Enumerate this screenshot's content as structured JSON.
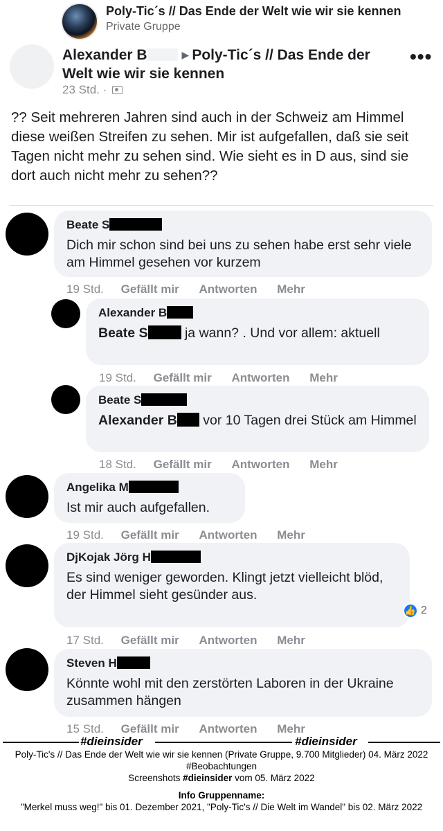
{
  "group": {
    "name": "Poly-Tic´s // Das Ende der Welt wie wir sie kennen",
    "type": "Private Gruppe"
  },
  "post": {
    "author": "Alexander B",
    "target_group_line1": "Poly-Tic´s // Das Ende der",
    "target_group_line2": "Welt wie wir sie kennen",
    "time": "23 Std. ·",
    "more_icon": "•••",
    "body": "?? Seit mehreren Jahren sind auch in der Schweiz am Himmel diese weißen Streifen zu sehen. Mir ist aufgefallen, daß sie seit Tagen nicht mehr zu sehen sind. Wie sieht es in D aus, sind sie dort auch nicht mehr zu sehen??"
  },
  "actions_labels": {
    "like": "Gefällt mir",
    "reply": "Antworten",
    "more": "Mehr"
  },
  "comments": [
    {
      "name": "Beate S",
      "text": "Dich mir schon sind bei uns zu sehen habe erst sehr viele am Himmel gesehen vor kurzem",
      "time": "19 Std."
    },
    {
      "name": "Alexander B",
      "mention": "Beate S",
      "text": "ja wann? . Und vor allem: aktuell",
      "time": "19 Std."
    },
    {
      "name": "Beate S",
      "mention": "Alexander B",
      "text": "vor 10 Tagen drei Stück am Himmel",
      "time": "18 Std."
    },
    {
      "name": "Angelika M",
      "text": "Ist mir auch aufgefallen.",
      "time": "19 Std."
    },
    {
      "name": "DjKojak Jörg H",
      "text": "Es sind weniger geworden. Klingt jetzt vielleicht blöd, der Himmel sieht gesünder aus.",
      "time": "17 Std.",
      "reactions": "2"
    },
    {
      "name": "Steven H",
      "text": "Könnte wohl mit den zerstörten Laboren in der Ukraine zusammen hängen",
      "time": "15 Std."
    }
  ],
  "footer": {
    "tag": "#dieinsider",
    "line1": "Poly-Tic's // Das Ende der Welt wie wir sie kennen (Private Gruppe, 9.700 Mitglieder) 04. März 2022",
    "line2": "#Beobachtungen",
    "line3_prefix": "Screenshots",
    "line3_tag": "#dieinsider",
    "line3_suffix": "vom 05. März 2022",
    "info_title": "Info Gruppenname:",
    "info_text": "\"Merkel muss weg!\" bis 01. Dezember 2021, \"Poly-Tic's // Die Welt im Wandel\" bis 02. März 2022"
  }
}
